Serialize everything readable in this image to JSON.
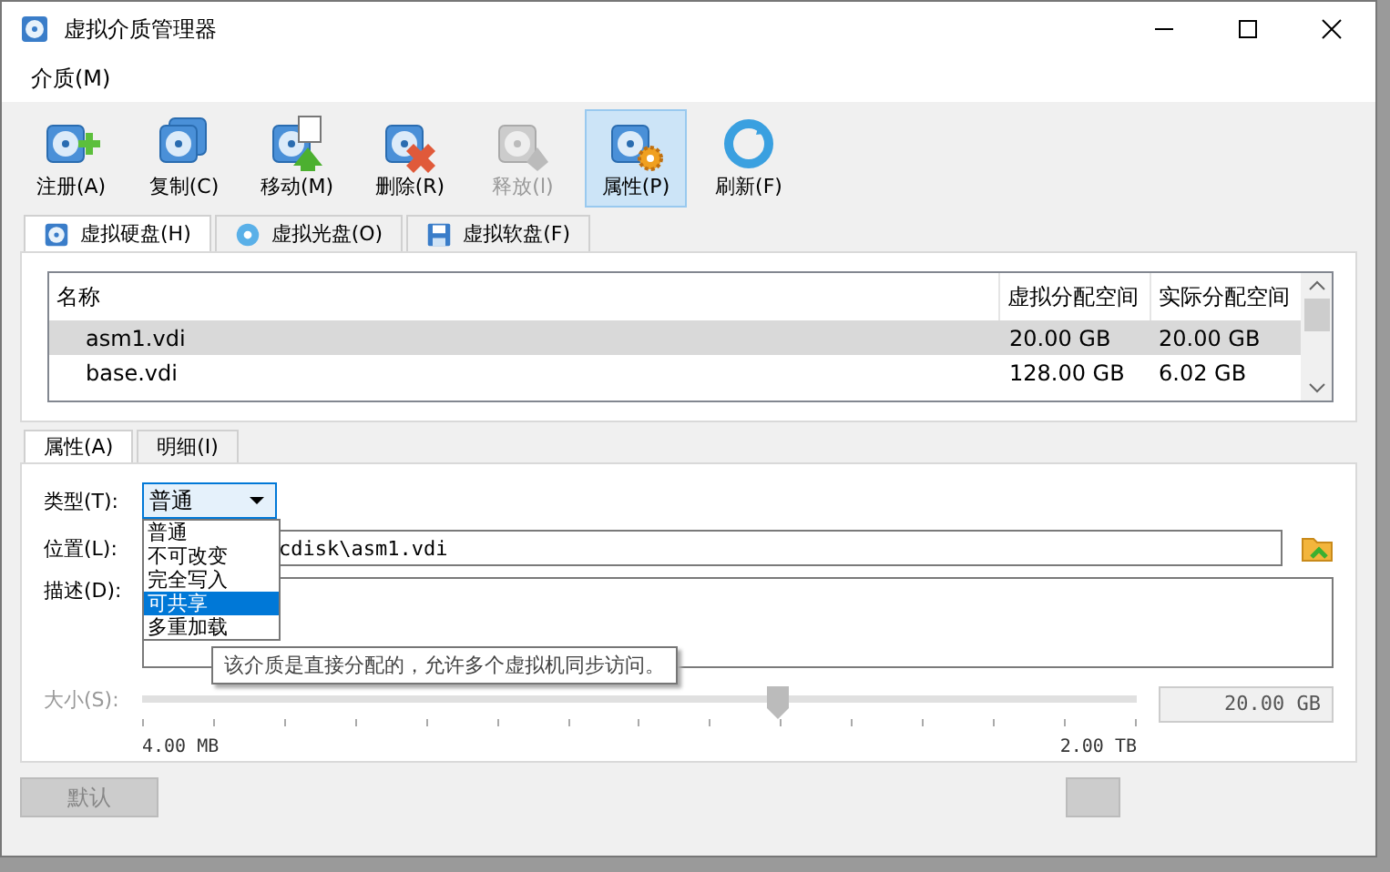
{
  "window": {
    "title": "虚拟介质管理器"
  },
  "menu": [
    "介质(M)"
  ],
  "toolbar": [
    {
      "kind": "add",
      "label": "注册(A)",
      "disabled": false,
      "selected": false
    },
    {
      "kind": "copy",
      "label": "复制(C)",
      "disabled": false,
      "selected": false
    },
    {
      "kind": "move",
      "label": "移动(M)",
      "disabled": false,
      "selected": false
    },
    {
      "kind": "remove",
      "label": "删除(R)",
      "disabled": false,
      "selected": false
    },
    {
      "kind": "release",
      "label": "释放(l)",
      "disabled": true,
      "selected": false
    },
    {
      "kind": "properties",
      "label": "属性(P)",
      "disabled": false,
      "selected": true
    },
    {
      "kind": "refresh",
      "label": "刷新(F)",
      "disabled": false,
      "selected": false
    }
  ],
  "media_tabs": [
    {
      "kind": "hdd",
      "label": "虚拟硬盘(H)",
      "selected": true
    },
    {
      "kind": "optical",
      "label": "虚拟光盘(O)",
      "selected": false
    },
    {
      "kind": "floppy",
      "label": "虚拟软盘(F)",
      "selected": false
    }
  ],
  "table": {
    "columns": [
      "名称",
      "虚拟分配空间",
      "实际分配空间"
    ],
    "rows": [
      {
        "cells": [
          "asm1.vdi",
          "20.00 GB",
          "20.00 GB"
        ],
        "selected": true
      },
      {
        "cells": [
          "base.vdi",
          "128.00 GB",
          "6.02 GB"
        ],
        "selected": false
      }
    ]
  },
  "detail_tabs": [
    {
      "label": "属性(A)",
      "selected": true
    },
    {
      "label": "明细(I)",
      "selected": false
    }
  ],
  "form": {
    "type_label": "类型(T):",
    "type_value": "普通",
    "type_options": [
      {
        "label": "普通",
        "selected": false
      },
      {
        "label": "不可改变",
        "selected": false
      },
      {
        "label": "完全写入",
        "selected": false
      },
      {
        "label": "可共享",
        "selected": true
      },
      {
        "label": "多重加载",
        "selected": false
      }
    ],
    "tooltip": "该介质是直接分配的，允许多个虚拟机同步访问。",
    "location_label": "位置(L):",
    "location_value": "cdisk\\asm1.vdi",
    "description_label": "描述(D):",
    "size_label": "大小(S):",
    "size_slider": {
      "level": 0.64
    },
    "size_min": "4.00 MB",
    "size_max": "2.00 TB",
    "size_value": "20.00 GB"
  },
  "buttons": [
    "默认"
  ]
}
